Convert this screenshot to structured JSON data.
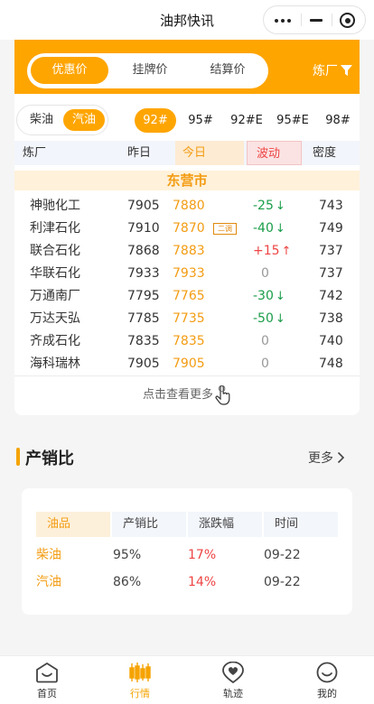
{
  "navbar": {
    "title": "油邦快讯"
  },
  "price_tabs": [
    "优惠价",
    "挂牌价",
    "结算价"
  ],
  "refinery_filter_label": "炼厂",
  "fuel_options": [
    "柴油",
    "汽油"
  ],
  "active_fuel": "汽油",
  "grades": [
    "92#",
    "95#",
    "92#E",
    "95#E",
    "98#"
  ],
  "active_grade": "92#",
  "table_headers": {
    "refinery": "炼厂",
    "yesterday": "昨日",
    "today": "今日",
    "change": "波动",
    "density": "密度"
  },
  "city": "东营市",
  "rows": [
    {
      "name": "神驰化工",
      "yesterday": "7905",
      "today": "7880",
      "change": "-25",
      "dir": "down",
      "density": "743"
    },
    {
      "name": "利津石化",
      "yesterday": "7910",
      "today": "7870",
      "tag": "二调",
      "change": "-40",
      "dir": "down",
      "density": "749"
    },
    {
      "name": "联合石化",
      "yesterday": "7868",
      "today": "7883",
      "change": "+15",
      "dir": "up",
      "density": "737"
    },
    {
      "name": "华联石化",
      "yesterday": "7933",
      "today": "7933",
      "change": "0",
      "dir": "flat",
      "density": "737"
    },
    {
      "name": "万通南厂",
      "yesterday": "7795",
      "today": "7765",
      "change": "-30",
      "dir": "down",
      "density": "742"
    },
    {
      "name": "万达天弘",
      "yesterday": "7785",
      "today": "7735",
      "change": "-50",
      "dir": "down",
      "density": "738"
    },
    {
      "name": "齐成石化",
      "yesterday": "7835",
      "today": "7835",
      "change": "0",
      "dir": "flat",
      "density": "740"
    },
    {
      "name": "海科瑞林",
      "yesterday": "7905",
      "today": "7905",
      "change": "0",
      "dir": "flat",
      "density": "748"
    }
  ],
  "view_more": "点击查看更多",
  "section": {
    "title": "产销比",
    "more": "更多"
  },
  "ratio_table": {
    "headers": [
      "油品",
      "产销比",
      "涨跌幅",
      "时间"
    ],
    "rows": [
      {
        "product": "柴油",
        "ratio": "95%",
        "change": "17%",
        "date": "09-22"
      },
      {
        "product": "汽油",
        "ratio": "86%",
        "change": "14%",
        "date": "09-22"
      }
    ]
  },
  "tabbar": [
    {
      "label": "首页",
      "icon": "home-icon"
    },
    {
      "label": "行情",
      "icon": "candlestick-icon",
      "active": true
    },
    {
      "label": "轨迹",
      "icon": "location-heart-icon"
    },
    {
      "label": "我的",
      "icon": "smile-face-icon"
    }
  ],
  "colors": {
    "accent": "#ffa500",
    "up": "#ee4444",
    "down": "#1a9d4a",
    "flat": "#999999"
  }
}
